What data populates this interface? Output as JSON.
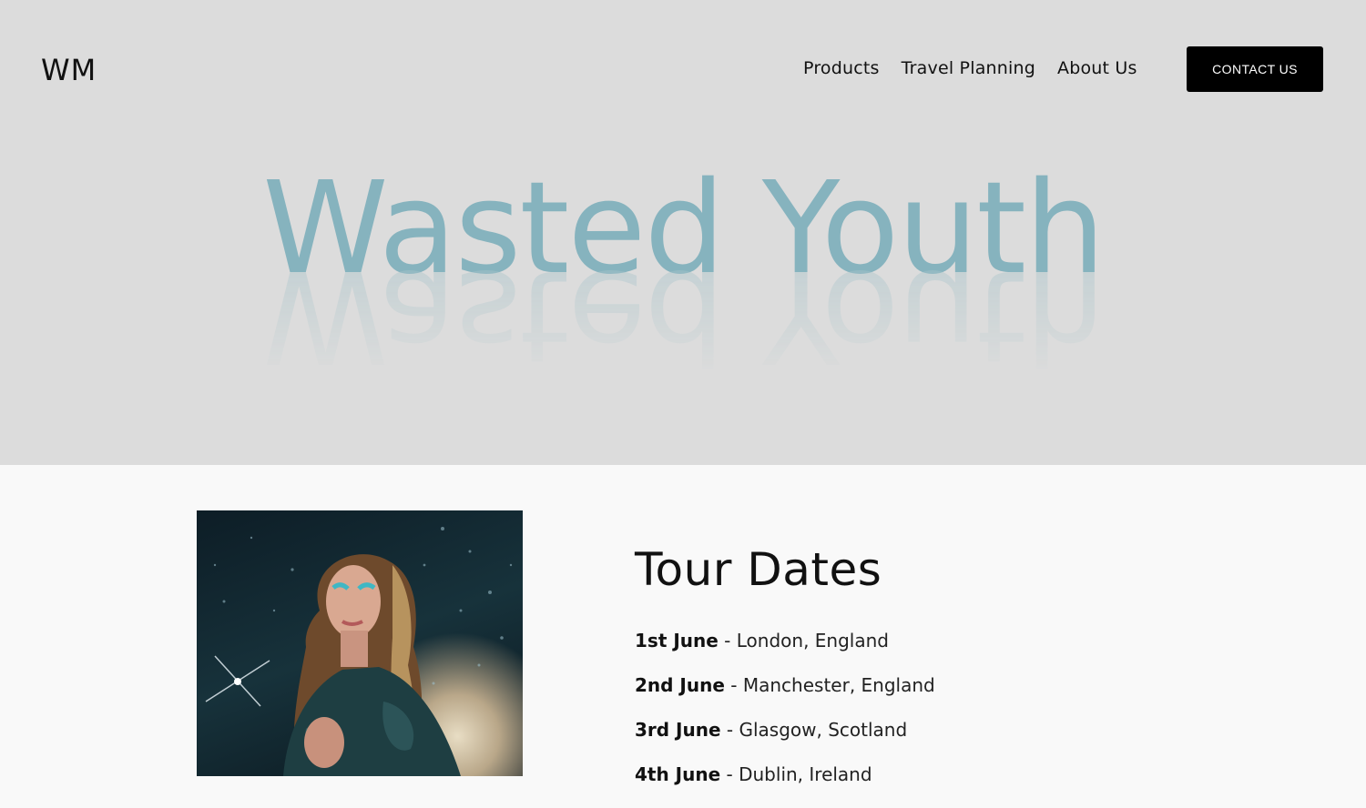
{
  "header": {
    "logo": "WM",
    "nav": [
      "Products",
      "Travel Planning",
      "About Us"
    ],
    "contact_label": "CONTACT US"
  },
  "hero": {
    "headline": "Wasted Youth"
  },
  "tour": {
    "title": "Tour Dates",
    "dates": [
      {
        "date": "1st June",
        "place": "London, England"
      },
      {
        "date": "2nd June",
        "place": "Manchester, England"
      },
      {
        "date": "3rd June",
        "place": "Glasgow, Scotland"
      },
      {
        "date": "4th June",
        "place": "Dublin, Ireland"
      }
    ]
  },
  "colors": {
    "hero_bg": "#dcdcdc",
    "headline": "#86b3be",
    "button_bg": "#000000"
  }
}
